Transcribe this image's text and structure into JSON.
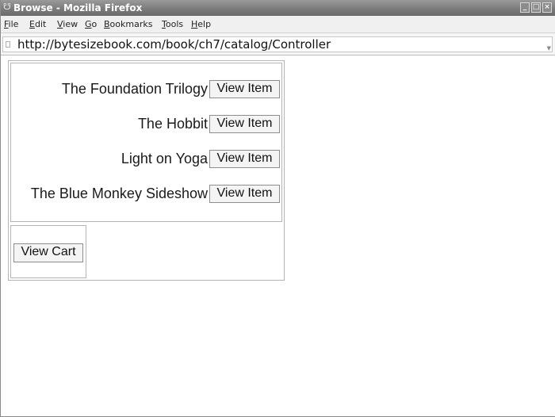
{
  "window": {
    "title": "Browse - Mozilla Firefox",
    "icon": "firefox-icon",
    "controls": [
      "minimize-icon",
      "maximize-icon",
      "close-icon"
    ]
  },
  "menu": {
    "items": [
      {
        "accel": "F",
        "rest": "ile"
      },
      {
        "accel": "E",
        "rest": "dit"
      },
      {
        "accel": "V",
        "rest": "iew"
      },
      {
        "accel": "G",
        "rest": "o"
      },
      {
        "accel": "B",
        "rest": "ookmarks"
      },
      {
        "accel": "T",
        "rest": "ools"
      },
      {
        "accel": "H",
        "rest": "elp"
      }
    ]
  },
  "address": {
    "url": "http://bytesizebook.com/book/ch7/catalog/Controller",
    "icon": "page-icon"
  },
  "catalog": {
    "items": [
      {
        "title": "The Foundation Trilogy",
        "button": "View Item"
      },
      {
        "title": "The Hobbit",
        "button": "View Item"
      },
      {
        "title": "Light on Yoga",
        "button": "View Item"
      },
      {
        "title": "The Blue Monkey Sideshow",
        "button": "View Item"
      }
    ],
    "cart_button": "View Cart"
  }
}
